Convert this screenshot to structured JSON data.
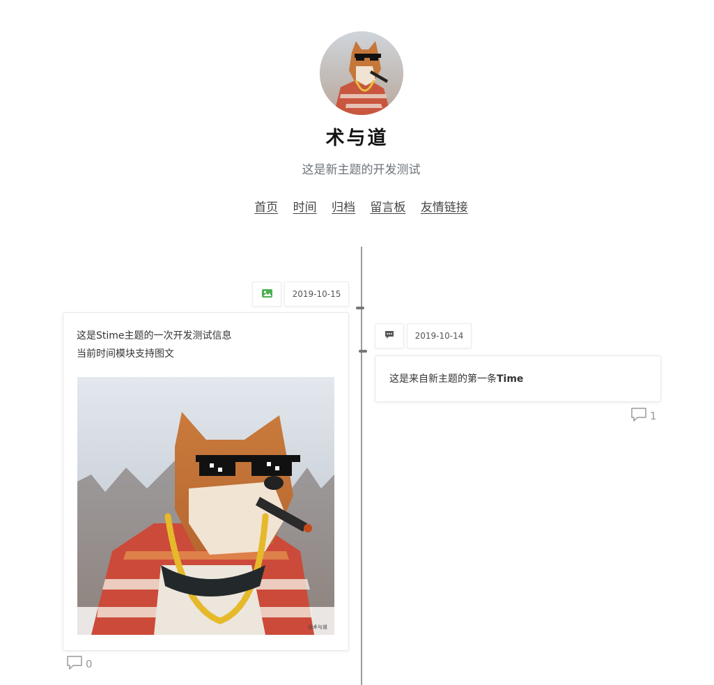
{
  "header": {
    "title": "术与道",
    "subtitle": "这是新主题的开发测试",
    "nav": [
      "首页",
      "时间",
      "归档",
      "留言板",
      "友情链接"
    ]
  },
  "posts": [
    {
      "date": "2019-10-15",
      "type_icon": "image-icon",
      "lines": [
        "这是Stime主题的一次开发测试信息",
        "当前时间模块支持图文"
      ],
      "image_watermark": "@术与道",
      "comment_count": "0"
    },
    {
      "date": "2019-10-14",
      "type_icon": "message-icon",
      "text_prefix": "这是来自新主题的第一条",
      "text_bold": "Time",
      "comment_count": "1"
    }
  ],
  "colors": {
    "image_icon": "#4caf50",
    "timeline": "#9b9b9b",
    "muted": "#999999"
  }
}
